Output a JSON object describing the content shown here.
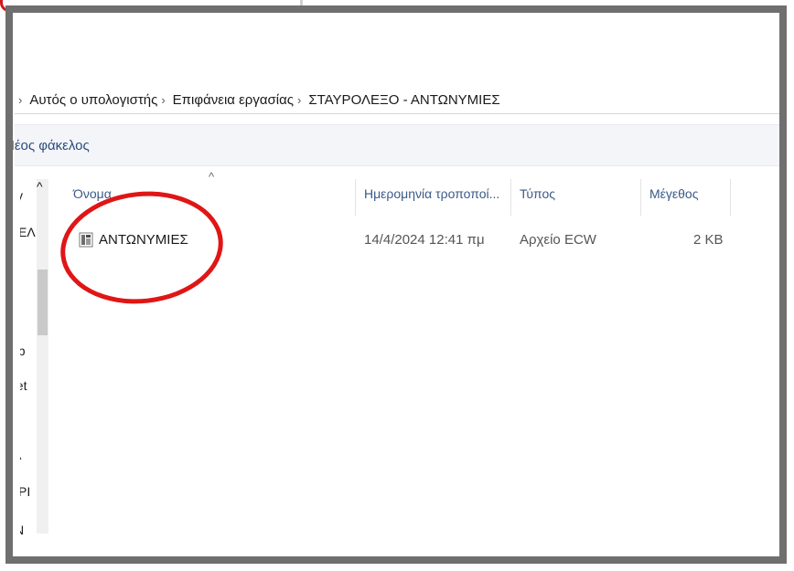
{
  "breadcrumb": {
    "items": [
      "Αυτός ο υπολογιστής",
      "Επιφάνεια εργασίας",
      "ΣΤΑΥΡΟΛΕΞΟ - ΑΝΤΩΝΥΜΙΕΣ"
    ]
  },
  "toolbar": {
    "new_folder_label": "Νέος φάκελος"
  },
  "navpane": {
    "visible_fragments": [
      "γ",
      "ΕΛ",
      "eb",
      "eet",
      "Α",
      "ΡΙ",
      "Ν"
    ]
  },
  "columns": {
    "name": "Όνομα",
    "date": "Ημερομηνία τροποποί...",
    "type": "Τύπος",
    "size": "Μέγεθος"
  },
  "files": [
    {
      "name": "ΑΝΤΩΝΥΜΙΕΣ",
      "date": "14/4/2024 12:41 πμ",
      "type": "Αρχείο ECW",
      "size": "2 KB",
      "icon": "ecw-file-icon"
    }
  ],
  "colors": {
    "window_border": "#6f6f6f",
    "highlight_circle": "#e01616",
    "toolbar_bg": "#f3f5f8"
  }
}
